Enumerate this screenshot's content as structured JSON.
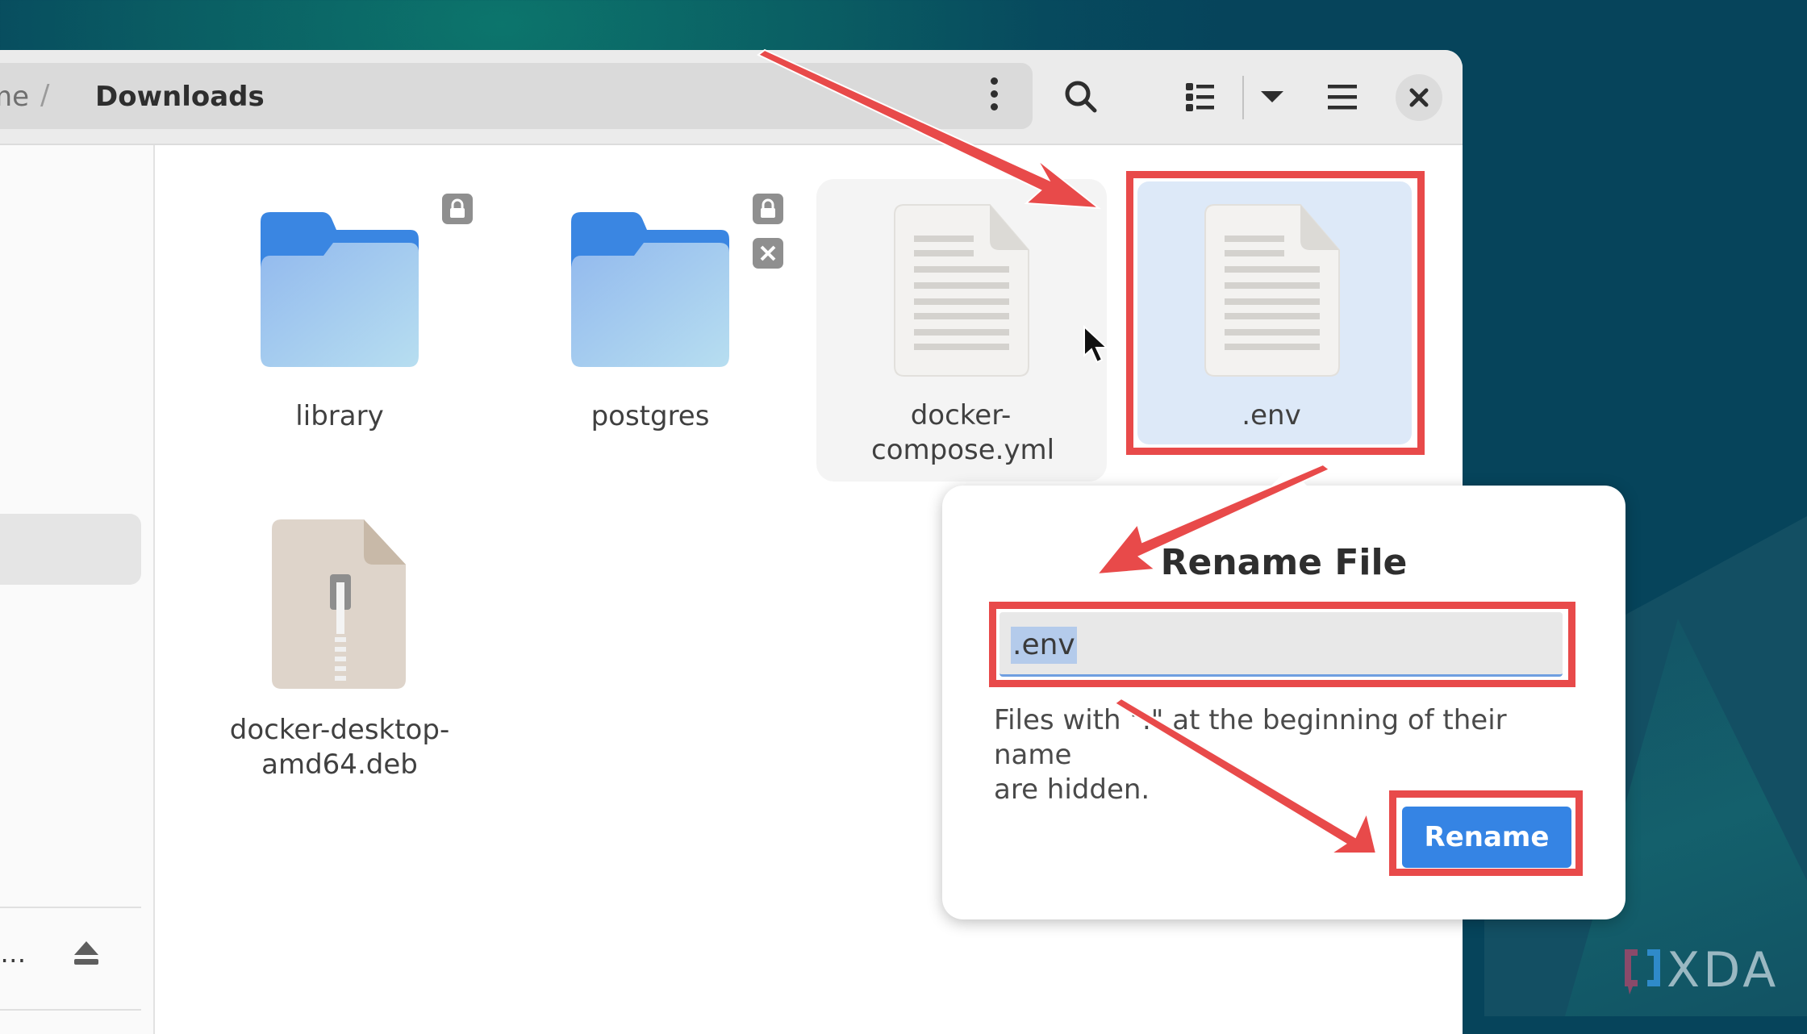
{
  "window": {
    "breadcrumb": {
      "previous": "me",
      "separator": "/",
      "current": "Downloads"
    },
    "toolbar": {
      "menu_icon": "kebab-menu-icon",
      "search_icon": "search-icon",
      "view_icon": "list-view-icon",
      "view_dropdown_icon": "chevron-down-icon",
      "main_menu_icon": "hamburger-menu-icon",
      "close_icon": "close-icon"
    },
    "sidebar": {
      "device_label": "n…",
      "eject_icon": "eject-icon"
    }
  },
  "files": [
    {
      "name": "library",
      "type": "folder",
      "emblems": [
        "lock"
      ]
    },
    {
      "name": "postgres",
      "type": "folder",
      "emblems": [
        "lock",
        "unreadable"
      ]
    },
    {
      "name_line1": "docker-",
      "name_line2": "compose.yml",
      "type": "text",
      "state": "hover"
    },
    {
      "name": ".env",
      "type": "text",
      "state": "selected"
    },
    {
      "name_line1": "docker-desktop-",
      "name_line2": "amd64.deb",
      "type": "archive"
    }
  ],
  "rename_popover": {
    "title": "Rename File",
    "input_value": ".env",
    "message_line1": "Files with \".\" at the beginning of their name",
    "message_line2": "are hidden.",
    "button_label": "Rename"
  },
  "colors": {
    "accent": "#3584e4",
    "annotation": "#e84a4a",
    "selection": "#dde9f8"
  },
  "watermark": {
    "text": "XDA"
  }
}
